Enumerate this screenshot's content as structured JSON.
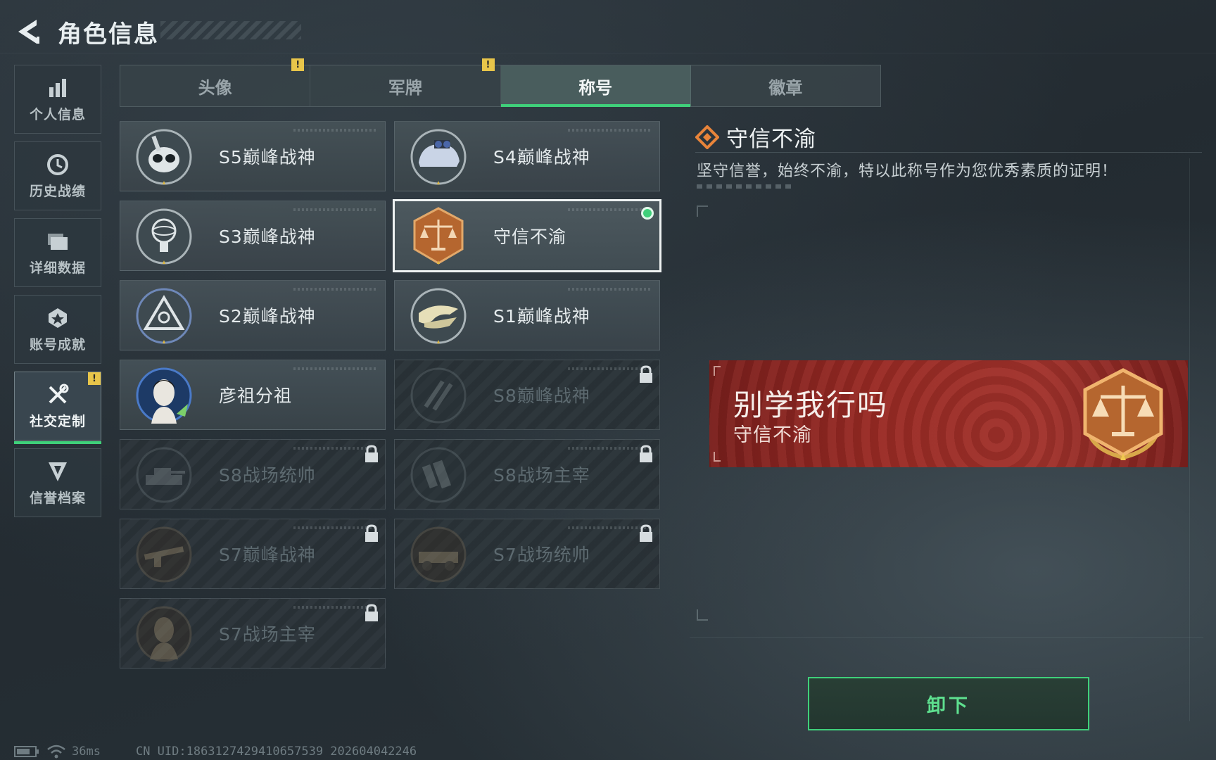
{
  "header": {
    "title": "角色信息"
  },
  "sidebar": {
    "items": [
      {
        "label": "个人信息",
        "icon": "bar-chart-icon"
      },
      {
        "label": "历史战绩",
        "icon": "history-clock-icon"
      },
      {
        "label": "详细数据",
        "icon": "folder-icon"
      },
      {
        "label": "账号成就",
        "icon": "achievement-icon"
      },
      {
        "label": "社交定制",
        "icon": "tools-icon",
        "active": true,
        "warning": "!"
      },
      {
        "label": "信誉档案",
        "icon": "credit-shield-icon"
      }
    ]
  },
  "tabs": [
    {
      "label": "头像",
      "warning": "!"
    },
    {
      "label": "军牌",
      "warning": "!"
    },
    {
      "label": "称号",
      "active": true
    },
    {
      "label": "徽章"
    }
  ],
  "titles": [
    {
      "label": "S5巅峰战神",
      "locked": false
    },
    {
      "label": "S4巅峰战神",
      "locked": false
    },
    {
      "label": "S3巅峰战神",
      "locked": false
    },
    {
      "label": "守信不渝",
      "locked": false,
      "selected": true,
      "equipped": true
    },
    {
      "label": "S2巅峰战神",
      "locked": false
    },
    {
      "label": "S1巅峰战神",
      "locked": false
    },
    {
      "label": "彦祖分祖",
      "locked": false
    },
    {
      "label": "S8巅峰战神",
      "locked": true
    },
    {
      "label": "S8战场统帅",
      "locked": true
    },
    {
      "label": "S8战场主宰",
      "locked": true
    },
    {
      "label": "S7巅峰战神",
      "locked": true
    },
    {
      "label": "S7战场统帅",
      "locked": true
    },
    {
      "label": "S7战场主宰",
      "locked": true
    }
  ],
  "detail": {
    "name": "守信不渝",
    "description": "坚守信誉，始终不渝，特以此称号作为您优秀素质的证明！",
    "nameplate": {
      "player_name": "别学我行吗",
      "title": "守信不渝"
    },
    "unequip_label": "卸下"
  },
  "footer": {
    "ping": "36ms",
    "uid": "CN UID:1863127429410657539 202604042246"
  },
  "colors": {
    "accent": "#3fd07a",
    "warning": "#e8c54a",
    "nameplate": "#9a2a24",
    "emblem": "#b5662f"
  }
}
